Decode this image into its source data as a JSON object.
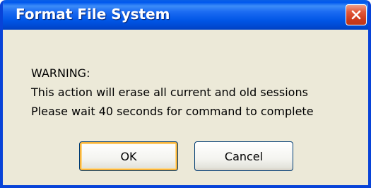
{
  "dialog": {
    "title": "Format File System",
    "close_icon": "close-icon",
    "message": {
      "line1": "WARNING:",
      "line2": "This action will erase all current and old sessions",
      "line3": "Please wait 40 seconds for command to complete"
    },
    "buttons": {
      "ok_label": "OK",
      "cancel_label": "Cancel"
    },
    "colors": {
      "titlebar": "#0055E5",
      "frame": "#0843D8",
      "body": "#ECE9D8",
      "close_button": "#E2583A",
      "default_button_highlight": "#F8B33A"
    }
  }
}
